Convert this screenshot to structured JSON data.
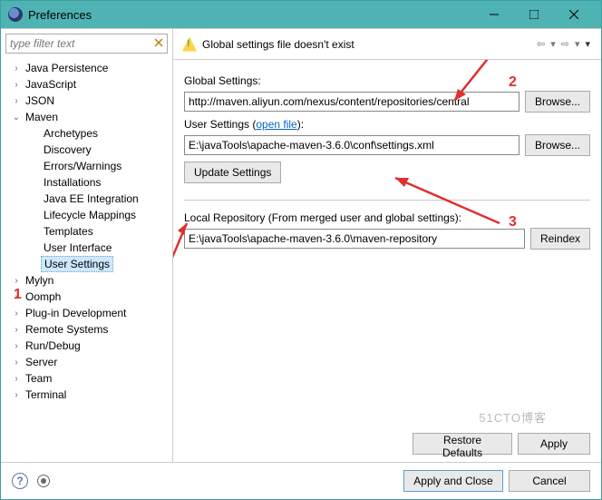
{
  "window": {
    "title": "Preferences"
  },
  "filter": {
    "placeholder": "type filter text"
  },
  "tree": {
    "items": [
      {
        "label": "Java Persistence",
        "depth": 1,
        "exp": ">"
      },
      {
        "label": "JavaScript",
        "depth": 1,
        "exp": ">"
      },
      {
        "label": "JSON",
        "depth": 1,
        "exp": ">"
      },
      {
        "label": "Maven",
        "depth": 1,
        "exp": "v"
      },
      {
        "label": "Archetypes",
        "depth": 2,
        "exp": ""
      },
      {
        "label": "Discovery",
        "depth": 2,
        "exp": ""
      },
      {
        "label": "Errors/Warnings",
        "depth": 2,
        "exp": ""
      },
      {
        "label": "Installations",
        "depth": 2,
        "exp": ""
      },
      {
        "label": "Java EE Integration",
        "depth": 2,
        "exp": ""
      },
      {
        "label": "Lifecycle Mappings",
        "depth": 2,
        "exp": ""
      },
      {
        "label": "Templates",
        "depth": 2,
        "exp": ""
      },
      {
        "label": "User Interface",
        "depth": 2,
        "exp": ""
      },
      {
        "label": "User Settings",
        "depth": 2,
        "exp": "",
        "sel": true
      },
      {
        "label": "Mylyn",
        "depth": 1,
        "exp": ">"
      },
      {
        "label": "Oomph",
        "depth": 1,
        "exp": ">"
      },
      {
        "label": "Plug-in Development",
        "depth": 1,
        "exp": ">"
      },
      {
        "label": "Remote Systems",
        "depth": 1,
        "exp": ">"
      },
      {
        "label": "Run/Debug",
        "depth": 1,
        "exp": ">"
      },
      {
        "label": "Server",
        "depth": 1,
        "exp": ">"
      },
      {
        "label": "Team",
        "depth": 1,
        "exp": ">"
      },
      {
        "label": "Terminal",
        "depth": 1,
        "exp": ">"
      }
    ]
  },
  "header": {
    "message": "Global settings file doesn't exist"
  },
  "form": {
    "global_label": "Global Settings:",
    "global_value": "http://maven.aliyun.com/nexus/content/repositories/central",
    "user_label_pre": "User Settings (",
    "user_link": "open file",
    "user_label_post": "):",
    "user_value": "E:\\javaTools\\apache-maven-3.6.0\\conf\\settings.xml",
    "browse": "Browse...",
    "update": "Update Settings",
    "local_label": "Local Repository (From merged user and global settings):",
    "local_value": "E:\\javaTools\\apache-maven-3.6.0\\maven-repository",
    "reindex": "Reindex",
    "restore": "Restore Defaults",
    "apply": "Apply"
  },
  "footer": {
    "apply_close": "Apply and Close",
    "cancel": "Cancel"
  },
  "annotations": {
    "n1": "1",
    "n2": "2",
    "n3": "3"
  },
  "watermark": "51CTO博客"
}
